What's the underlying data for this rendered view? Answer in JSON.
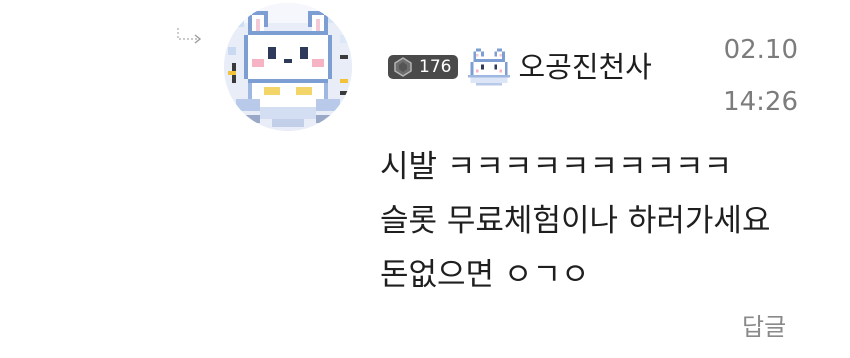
{
  "comment": {
    "author": {
      "level": "176",
      "nickname": "오공진천사",
      "icons": {
        "reply_indicator": "reply-arrow-icon",
        "level_gem": "gem-icon",
        "badge": "bunny-mascot-icon"
      }
    },
    "date": "02.10",
    "time": "14:26",
    "message_lines": [
      "시발 ㅋㅋㅋㅋㅋㅋㅋㅋㅋㅋ",
      "슬롯 무료체험이나 하러가세요",
      "돈없으면 ㅇㄱㅇ"
    ],
    "reply_label": "답글"
  },
  "colors": {
    "badge_bg": "#4a4a4a",
    "timestamp": "#7c7c7c",
    "reply_label": "#8a8a8a",
    "text": "#1f1f1f"
  }
}
